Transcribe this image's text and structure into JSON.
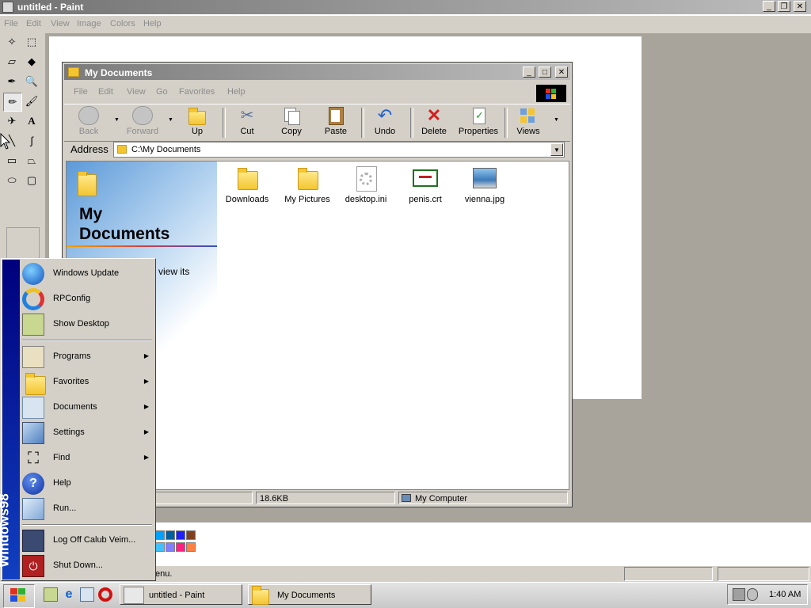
{
  "paint": {
    "title": "untitled - Paint",
    "menu": [
      "File",
      "Edit",
      "View",
      "Image",
      "Colors",
      "Help"
    ],
    "status_text": "enu."
  },
  "explorer": {
    "title": "My Documents",
    "menu": [
      "File",
      "Edit",
      "View",
      "Go",
      "Favorites",
      "Help"
    ],
    "toolbar": [
      {
        "label": "Back",
        "icon": "back-arrow-icon",
        "enabled": false
      },
      {
        "label": "Forward",
        "icon": "forward-arrow-icon",
        "enabled": false
      },
      {
        "label": "Up",
        "icon": "up-folder-icon",
        "enabled": true
      },
      {
        "label": "Cut",
        "icon": "scissors-icon",
        "enabled": true
      },
      {
        "label": "Copy",
        "icon": "copy-icon",
        "enabled": true
      },
      {
        "label": "Paste",
        "icon": "clipboard-icon",
        "enabled": true
      },
      {
        "label": "Undo",
        "icon": "undo-icon",
        "enabled": true
      },
      {
        "label": "Delete",
        "icon": "delete-x-icon",
        "enabled": true
      },
      {
        "label": "Properties",
        "icon": "properties-icon",
        "enabled": true
      },
      {
        "label": "Views",
        "icon": "views-icon",
        "enabled": true
      }
    ],
    "address_label": "Address",
    "address_value": "C:\\My Documents",
    "webview_title_line1": "My",
    "webview_title_line2": "Documents",
    "webview_hint": "view its",
    "files": [
      {
        "name": "Downloads",
        "icon": "folder-icon"
      },
      {
        "name": "My Pictures",
        "icon": "folder-icon"
      },
      {
        "name": "desktop.ini",
        "icon": "settings-file-icon"
      },
      {
        "name": "penis.crt",
        "icon": "certificate-icon"
      },
      {
        "name": "vienna.jpg",
        "icon": "image-file-icon"
      }
    ],
    "status": {
      "size": "18.6KB",
      "zone": "My Computer"
    }
  },
  "start_menu": {
    "banner": "Windows98",
    "top_items": [
      {
        "label": "Windows Update",
        "icon": "globe-icon"
      },
      {
        "label": "RPConfig",
        "icon": "rpconfig-icon"
      },
      {
        "label": "Show Desktop",
        "icon": "show-desktop-icon"
      }
    ],
    "main_items": [
      {
        "label": "Programs",
        "icon": "programs-icon",
        "submenu": true
      },
      {
        "label": "Favorites",
        "icon": "favorites-folder-icon",
        "submenu": true
      },
      {
        "label": "Documents",
        "icon": "documents-icon",
        "submenu": true
      },
      {
        "label": "Settings",
        "icon": "settings-icon",
        "submenu": true
      },
      {
        "label": "Find",
        "icon": "binoculars-icon",
        "submenu": true
      },
      {
        "label": "Help",
        "icon": "help-icon",
        "submenu": false
      },
      {
        "label": "Run...",
        "icon": "run-icon",
        "submenu": false
      }
    ],
    "bottom_items": [
      {
        "label": "Log Off Calub Veim...",
        "icon": "lock-icon"
      },
      {
        "label": "Shut Down...",
        "icon": "power-icon"
      }
    ]
  },
  "taskbar": {
    "tasks": [
      {
        "label": "untitled - Paint",
        "icon": "paint-icon"
      },
      {
        "label": "My Documents",
        "icon": "folder-icon"
      }
    ],
    "clock": "1:40 AM"
  },
  "colors": {
    "palette": [
      "#00a0ff",
      "#0060a0",
      "#2020ff",
      "#804020",
      "#40c0ff",
      "#8080ff",
      "#ff2080",
      "#ff8040"
    ]
  }
}
